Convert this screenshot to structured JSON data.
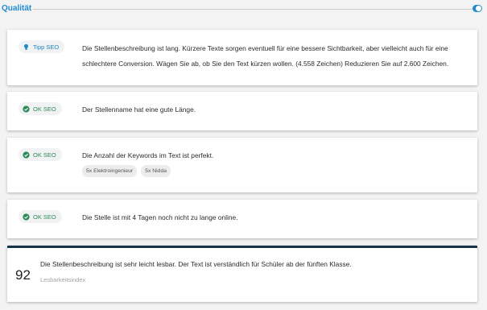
{
  "header": {
    "title": "Qualität",
    "toggle_on": true
  },
  "cards": [
    {
      "badge": "Tipp SEO",
      "badge_icon": "lightbulb-icon",
      "line1": "Die Stellenbeschreibung ist lang. Kürzere Texte sorgen eventuell für eine bessere Sichtbarkeit, aber vielleicht auch für eine",
      "line2": "schlechtere Conversion. Wägen Sie ab, ob Sie den Text kürzen wollen. (4.558 Zeichen) Reduzieren Sie auf 2.600 Zeichen."
    },
    {
      "badge": "OK SEO",
      "badge_icon": "check-circle-icon",
      "text": "Der Stellenname hat eine gute Länge."
    },
    {
      "badge": "OK SEO",
      "badge_icon": "check-circle-icon",
      "text": "Die Anzahl der Keywords im Text ist perfekt.",
      "keywords": [
        "5x Elektroingenieur",
        "5x Nidda"
      ]
    },
    {
      "badge": "OK SEO",
      "badge_icon": "check-circle-icon",
      "text": "Die Stelle ist mit 4 Tagen noch nicht zu lange online."
    }
  ],
  "readability": {
    "score": "92",
    "text": "Die Stellenbeschreibung ist sehr leicht lesbar. Der Text ist verständlich für Schüler ab der fünften Klasse.",
    "label": "Lesbarkeitsindex"
  },
  "colors": {
    "accent": "#1f8ccf",
    "ok": "#2e8b57",
    "score_bar": "#153347"
  }
}
